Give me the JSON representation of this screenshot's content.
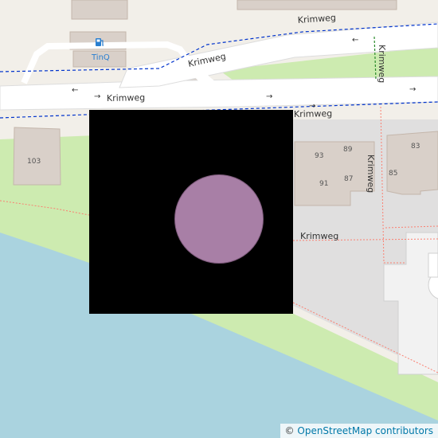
{
  "map": {
    "street_name": "Krimweg",
    "poi_label": "TinQ",
    "poi_icon": "fuel-pump-icon",
    "house_numbers": [
      "103",
      "93",
      "89",
      "91",
      "87",
      "83",
      "85"
    ],
    "colors": {
      "land": "#f2efe9",
      "water": "#aad3df",
      "grass": "#cdebb0",
      "residential": "#e0dfdf",
      "building": "#d9d0c9",
      "road": "#ffffff",
      "marker": "#a87fa6",
      "overlay": "#000000"
    }
  },
  "attribution": {
    "symbol": "©",
    "text": "OpenStreetMap contributors"
  }
}
